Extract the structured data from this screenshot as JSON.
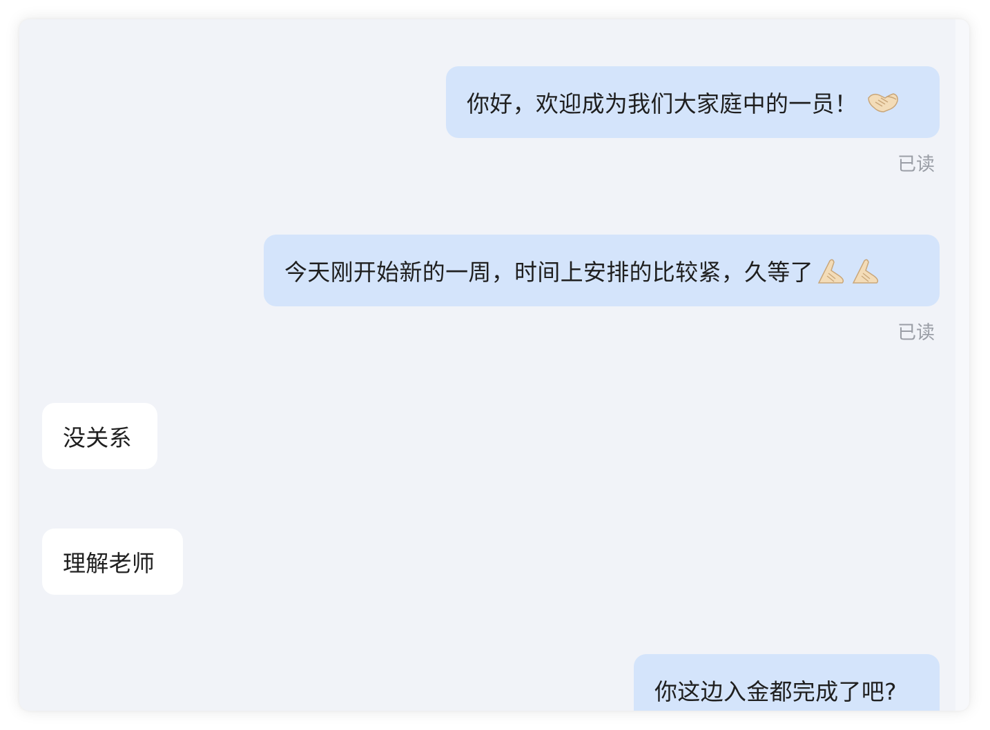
{
  "chat": {
    "messages": [
      {
        "side": "sent",
        "text": "你好，欢迎成为我们大家庭中的一员！",
        "emoji": "handshake-icon",
        "status": "已读"
      },
      {
        "side": "sent",
        "text": "今天刚开始新的一周，时间上安排的比较紧，久等了",
        "emoji": "folded-hands-icon",
        "status": "已读"
      },
      {
        "side": "recv",
        "text": "没关系"
      },
      {
        "side": "recv",
        "text": "理解老师"
      },
      {
        "side": "sent",
        "text": "你这边入金都完成了吧?"
      }
    ]
  },
  "colors": {
    "background": "#f1f3f8",
    "sent_bubble": "#d4e4fb",
    "received_bubble": "#ffffff",
    "read_status": "#9a9ea6"
  }
}
